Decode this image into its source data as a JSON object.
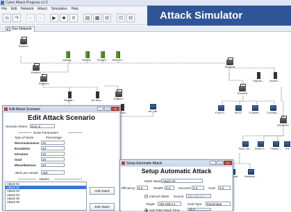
{
  "app": {
    "title": "Cyber Attack Progress v1.3"
  },
  "menu": [
    "File",
    "Edit",
    "Network",
    "Attack",
    "Simulation",
    "Help"
  ],
  "toolbar": [
    "⎌",
    "↷",
    "▫",
    "▫",
    "▶",
    "■",
    "II",
    "▤",
    "▦",
    "⊟",
    "⊡",
    "⊟"
  ],
  "tab": {
    "label": "Dos Network"
  },
  "banner": {
    "text": "Attack Simulator"
  },
  "nodes": {
    "router1": "Router1",
    "router2": "Router2",
    "router3": "Router3",
    "router5": "Router5",
    "router7": "Router7",
    "router8": "Router8",
    "router9": "Router9",
    "router10": "Router10",
    "web": "Websit...",
    "file": "FileSer...",
    "email": "EmailS...",
    "dns": "DNS Se...",
    "regist": "Registr...",
    "artmus": "Art Mus...",
    "payroll": "Payroll...",
    "oracle": "Oracle ...",
    "fooda": "Food S...",
    "b4t2": "B4T2",
    "crosser": "Crosser...",
    "comm": "Comma...",
    "artsec": "Art Sec...",
    "artlab": "Art Lab",
    "floorse": "Floor Se...",
    "dedit": "Dedit S...",
    "finance": "Financ...",
    "pa": "Pa",
    "ocelab": "OCO Lab",
    "webmst": "Webmst..."
  },
  "edit_dialog": {
    "title": "Edit Attack Scenario",
    "heading": "Edit Attack Scenario",
    "name_label": "Scenario Name:",
    "name_value": "Dos_5",
    "noise_legend": "Noise Parameters",
    "col_type": "Type of Noise",
    "col_pct": "Percentage",
    "rows": [
      {
        "label": "Reconnaissance",
        "value": "20"
      },
      {
        "label": "Escalation",
        "value": "20"
      },
      {
        "label": "Intrusion",
        "value": "20"
      },
      {
        "label": "Goal",
        "value": "20"
      },
      {
        "label": "Miscellaneous",
        "value": "20"
      }
    ],
    "alerts_label": "Alerts per minute",
    "alerts_value": "150",
    "attacks_legend": "Attacks",
    "attacks": [
      "Attack 01",
      "Attack 02",
      "Attack 03",
      "Attack 04",
      "Attack 05",
      "Attack 06"
    ],
    "selected_index": 1,
    "add_btn": "Add Attack",
    "edit_btn": "Edit Attack"
  },
  "setup_dialog": {
    "title": "Setup Automatic Attack",
    "heading": "Setup Automatic Attack",
    "name_label": "Attack Name:",
    "name_value": "Attack 02",
    "eff_label": "Efficiency:",
    "eff_value": "5.0",
    "stealth_label": "Stealth:",
    "stealth_value": "0.0",
    "success_label": "Success:",
    "success_value": "5.0",
    "goal_label": "Goal:",
    "goal_value": "5.0",
    "internal_label": "Internal Attack",
    "source_label": "Source:",
    "source_value": "192.168.4.1",
    "target_label": "Target:",
    "target_value": "192.168.4.1",
    "goaltype_label": "Goal Type:",
    "goaltype_value": "Espionage",
    "total_label": "Use Total Attack Time:",
    "total_value": "35.0"
  }
}
